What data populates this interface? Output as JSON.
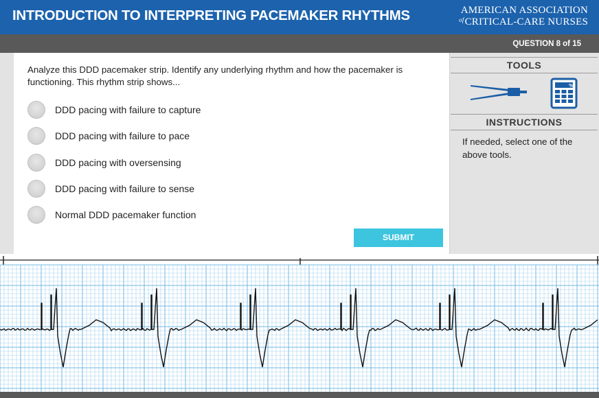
{
  "header": {
    "title": "INTRODUCTION TO INTERPRETING PACEMAKER RHYTHMS",
    "logo_line1": "AMERICAN ASSOCIATION",
    "logo_of": "of",
    "logo_line2": "CRITICAL-CARE NURSES"
  },
  "question_bar": {
    "label": "QUESTION 8 of 15"
  },
  "question": {
    "text": "Analyze this DDD pacemaker strip. Identify any underlying rhythm and how the pacemaker is functioning. This rhythm strip shows...",
    "options": [
      {
        "label": "DDD pacing with failure to capture"
      },
      {
        "label": "DDD pacing with failure to pace"
      },
      {
        "label": "DDD pacing with oversensing"
      },
      {
        "label": "DDD pacing with failure to sense"
      },
      {
        "label": "Normal DDD pacemaker function"
      }
    ],
    "submit_label": "SUBMIT"
  },
  "sidebar": {
    "tools_heading": "TOOLS",
    "tools": [
      {
        "name": "caliper-icon"
      },
      {
        "name": "calculator-icon"
      }
    ],
    "instructions_heading": "INSTRUCTIONS",
    "instructions_text": "If needed, select one of the above tools."
  },
  "colors": {
    "header_blue": "#1c62ad",
    "bar_gray": "#595959",
    "panel_gray": "#e3e3e3",
    "submit_cyan": "#3dc4df",
    "icon_blue": "#1b5ea6",
    "grid_blue": "#6fb6e4",
    "trace": "#111111"
  }
}
